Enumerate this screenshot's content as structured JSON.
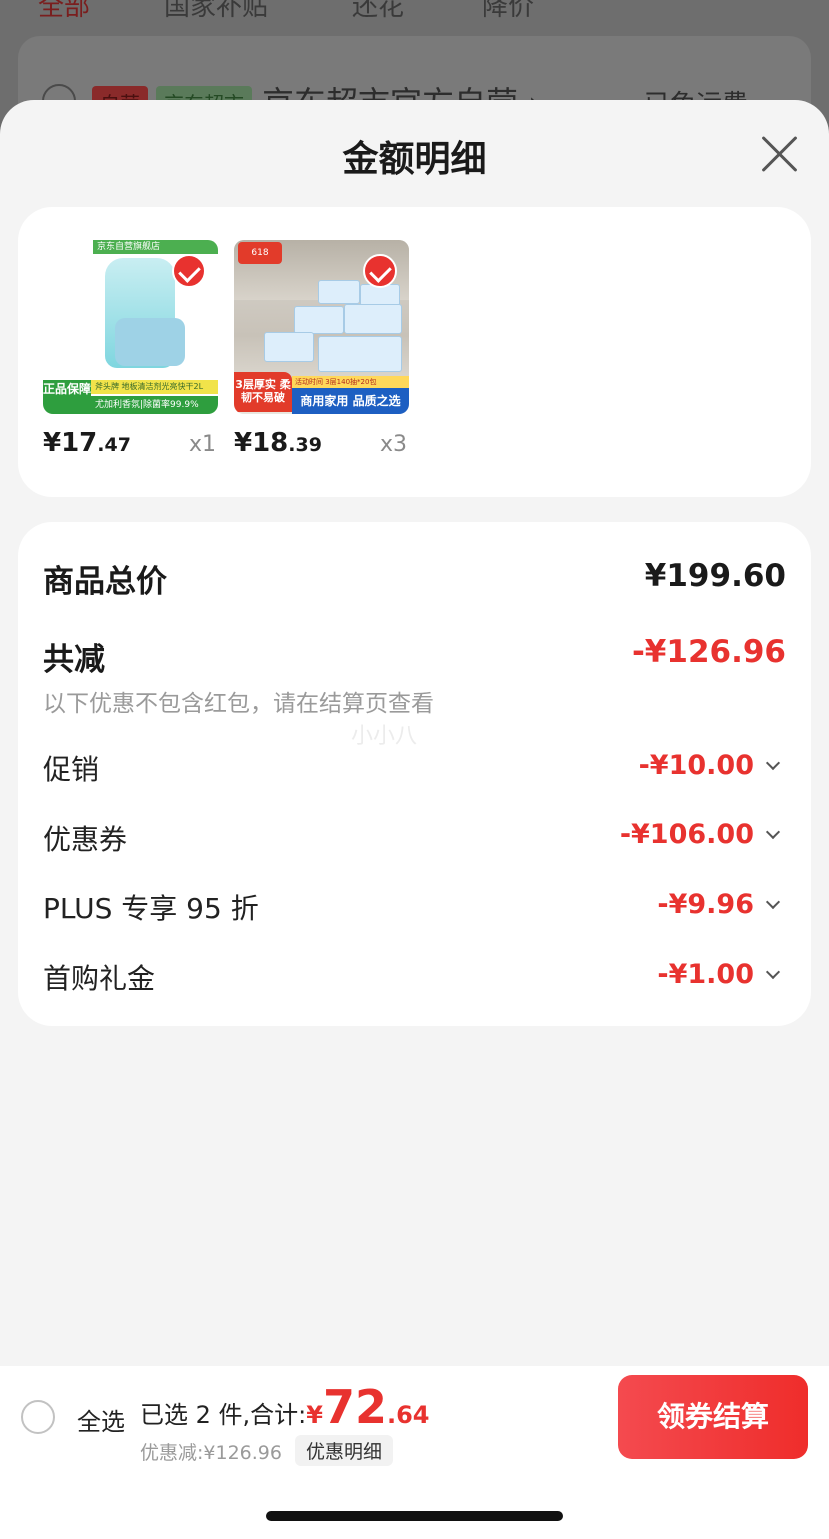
{
  "background": {
    "tabs": [
      "全部",
      "国家补贴",
      "还花",
      "降价"
    ],
    "badge_self": "自营",
    "badge_store": "京东超市",
    "shop_name": "京东超市官方自营 ›",
    "shipping": "已免运费"
  },
  "sheet": {
    "title": "金额明细",
    "close_icon": "close-icon"
  },
  "products": [
    {
      "image": "axe-floor-cleaner-product-image",
      "image_texts": {
        "store_strip": "京东自营旗舰店",
        "guarantee": "正品保障",
        "desc1": "斧头牌 地板清洁剂光亮快干2L",
        "desc2": "尤加利香氛|除菌率99.9%"
      },
      "price_int": "¥17",
      "price_dec": ".47",
      "qty": "x1",
      "checked": true
    },
    {
      "image": "tissue-pack-product-image",
      "image_texts": {
        "logo": "618",
        "red_tag": "3层厚实 柔韧不易破",
        "bar": "活动时间 3层140抽*20包",
        "blue_tag": "商用家用 品质之选"
      },
      "price_int": "¥18",
      "price_dec": ".39",
      "qty": "x3",
      "checked": true
    }
  ],
  "summary": {
    "total_label": "商品总价",
    "total_value": "¥199.60",
    "reduce_label": "共减",
    "reduce_value": "-¥126.96",
    "note": "以下优惠不包含红包，请在结算页查看",
    "watermark": "小小八",
    "items": [
      {
        "label": "促销",
        "value": "-¥10.00"
      },
      {
        "label": "优惠券",
        "value": "-¥106.00"
      },
      {
        "label": "PLUS 专享 95 折",
        "value": "-¥9.96"
      },
      {
        "label": "首购礼金",
        "value": "-¥1.00"
      }
    ]
  },
  "bottom": {
    "select_all": "全选",
    "total_label": "已选 2 件,合计:",
    "yen": "¥",
    "total_int": "72",
    "total_dec": ".64",
    "discount": "优惠减:¥126.96",
    "detail_chip": "优惠明细",
    "checkout": "领券结算"
  },
  "colors": {
    "accent_red": "#e8322f",
    "checkout_gradient_start": "#f44a4f",
    "checkout_gradient_end": "#ef2d2b",
    "sheet_bg": "#f4f4f4",
    "overlay": "#6b6b6b"
  }
}
